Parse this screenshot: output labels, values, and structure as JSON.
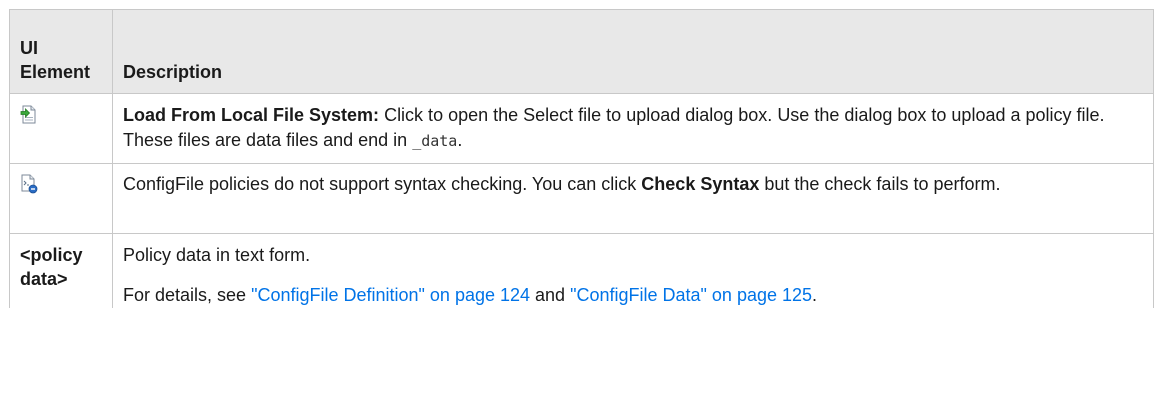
{
  "table": {
    "headers": {
      "ui_element": "UI Element",
      "description": "Description"
    },
    "rows": [
      {
        "element_icon": "load-from-file-icon",
        "description": {
          "bold_lead": "Load From Local File System:",
          "text_before_code": " Click to open the Select file to upload dialog box. Use the dialog box to upload a policy file. These files are data files and end in ",
          "code": "_data",
          "text_after_code": "."
        }
      },
      {
        "element_icon": "check-syntax-icon",
        "description": {
          "text_before_bold": "ConfigFile policies do not support syntax checking. You can click ",
          "bold": "Check Syntax",
          "text_after_bold": " but the check fails to perform."
        }
      },
      {
        "element_label": "<policy data>",
        "description": {
          "line1": "Policy data in text form.",
          "details_prefix": "For details, see ",
          "link1": "\"ConfigFile Definition\" on page 124",
          "details_middle": " and ",
          "link2": "\"ConfigFile Data\" on page 125",
          "details_suffix": "."
        }
      }
    ]
  },
  "colors": {
    "header_bg": "#e8e8e8",
    "border": "#c8c8c8",
    "link": "#0073e7",
    "icon_green": "#3aa83a",
    "icon_blue": "#2a6cc4"
  }
}
